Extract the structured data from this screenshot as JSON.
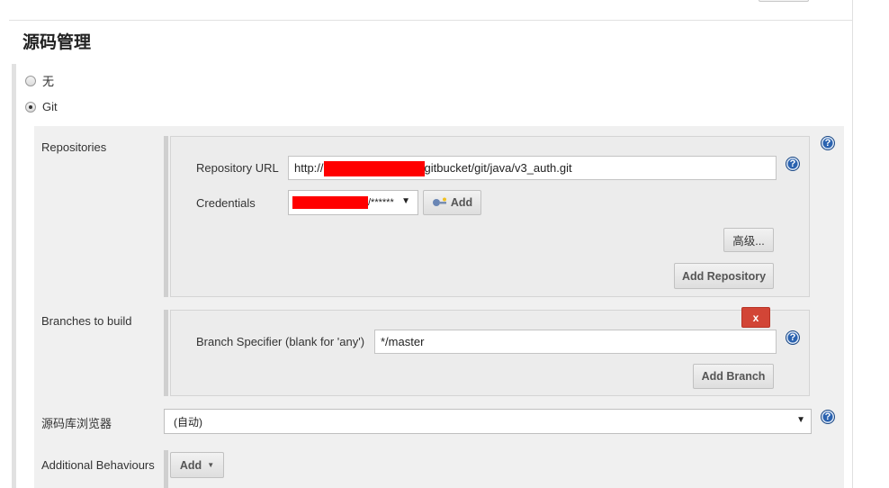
{
  "section": {
    "title": "源码管理"
  },
  "scm": {
    "options": [
      {
        "label": "无",
        "checked": false
      },
      {
        "label": "Git",
        "checked": true
      }
    ]
  },
  "repositories": {
    "label": "Repositories",
    "url_label": "Repository URL",
    "url_prefix": "http://",
    "url_suffix": "gitbucket/git/java/v3_auth.git",
    "credentials_label": "Credentials",
    "credentials_value": "/******",
    "add_credentials_label": "Add",
    "advanced_label": "高级...",
    "add_repository_label": "Add Repository"
  },
  "branches": {
    "label": "Branches to build",
    "delete_label": "x",
    "specifier_label": "Branch Specifier (blank for 'any')",
    "specifier_value": "*/master",
    "add_branch_label": "Add Branch"
  },
  "browser": {
    "label": "源码库浏览器",
    "value": "(自动)"
  },
  "behaviours": {
    "label": "Additional Behaviours",
    "add_label": "Add"
  },
  "icons": {
    "help": "help-icon",
    "key": "key-icon",
    "dropdown": "dropdown-arrow-icon"
  },
  "colors": {
    "help_blue": "#2b63b0",
    "delete_red": "#d24536",
    "redaction": "#ff0000"
  }
}
